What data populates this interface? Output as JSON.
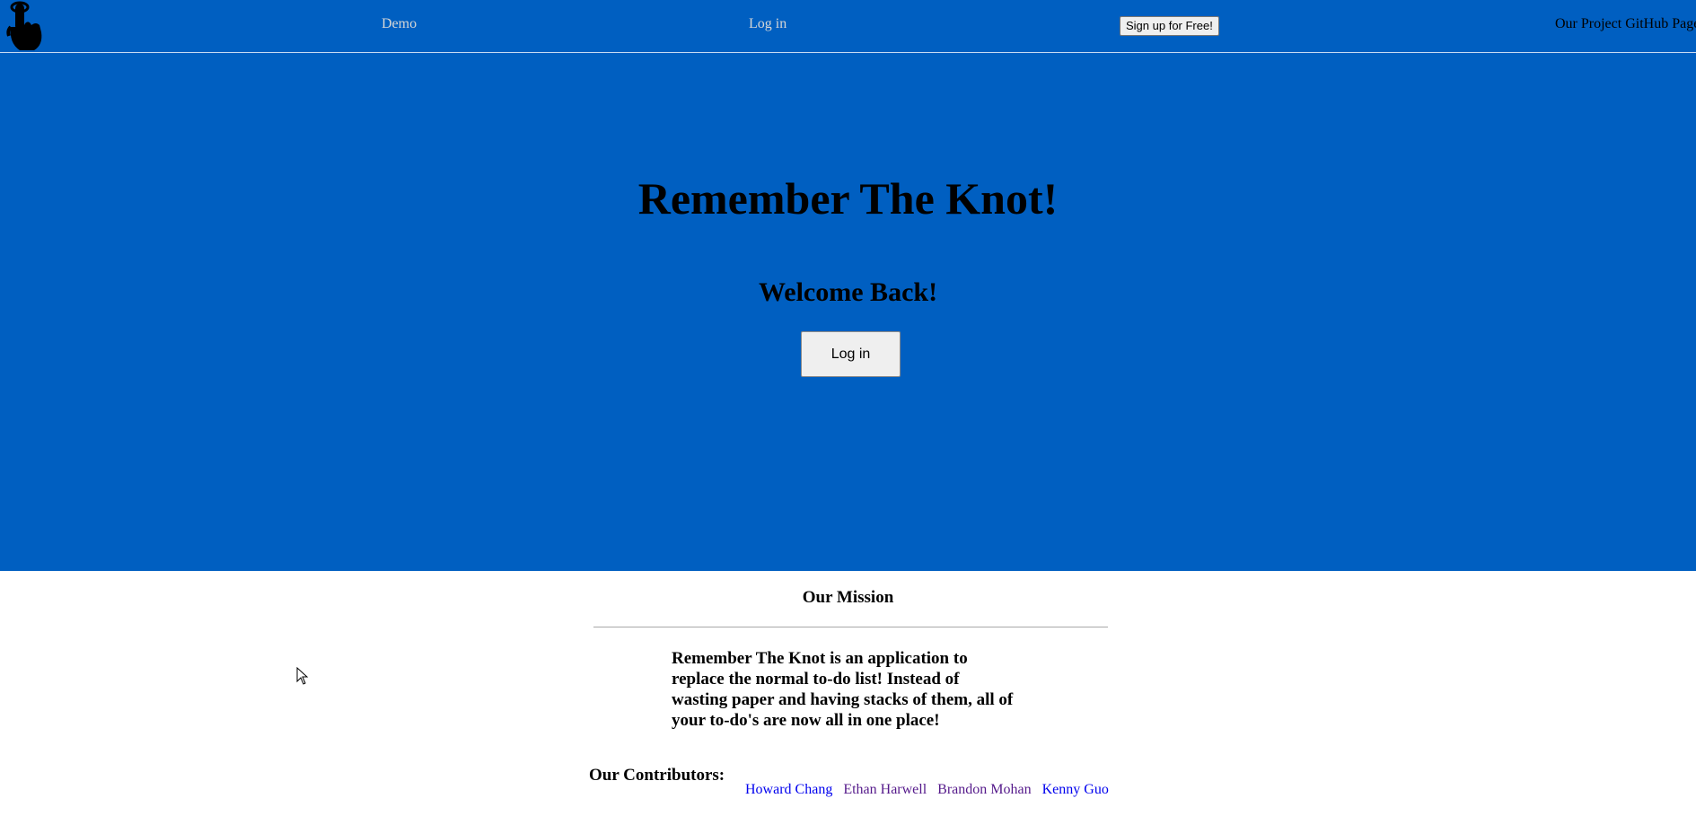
{
  "nav": {
    "logo_icon": "pointing-hand-knot-icon",
    "demo_label": "Demo",
    "login_label": "Log in",
    "signup_label": "Sign up for Free!",
    "github_label": "Our Project GitHub Page"
  },
  "hero": {
    "background_color": "#005fc1",
    "title": "Remember The Knot!",
    "welcome": "Welcome Back!",
    "login_button": "Log in"
  },
  "mission": {
    "heading": "Our Mission",
    "text": "Remember The Knot is an application to replace the normal to-do list! Instead of wasting paper and having stacks of them, all of your to-do's are now all in one place!"
  },
  "contributors": {
    "label": "Our Contributors:",
    "people": [
      {
        "name": "Howard Chang",
        "visited": false
      },
      {
        "name": "Ethan Harwell",
        "visited": true
      },
      {
        "name": "Brandon Mohan",
        "visited": true
      },
      {
        "name": "Kenny Guo",
        "visited": false
      }
    ]
  }
}
